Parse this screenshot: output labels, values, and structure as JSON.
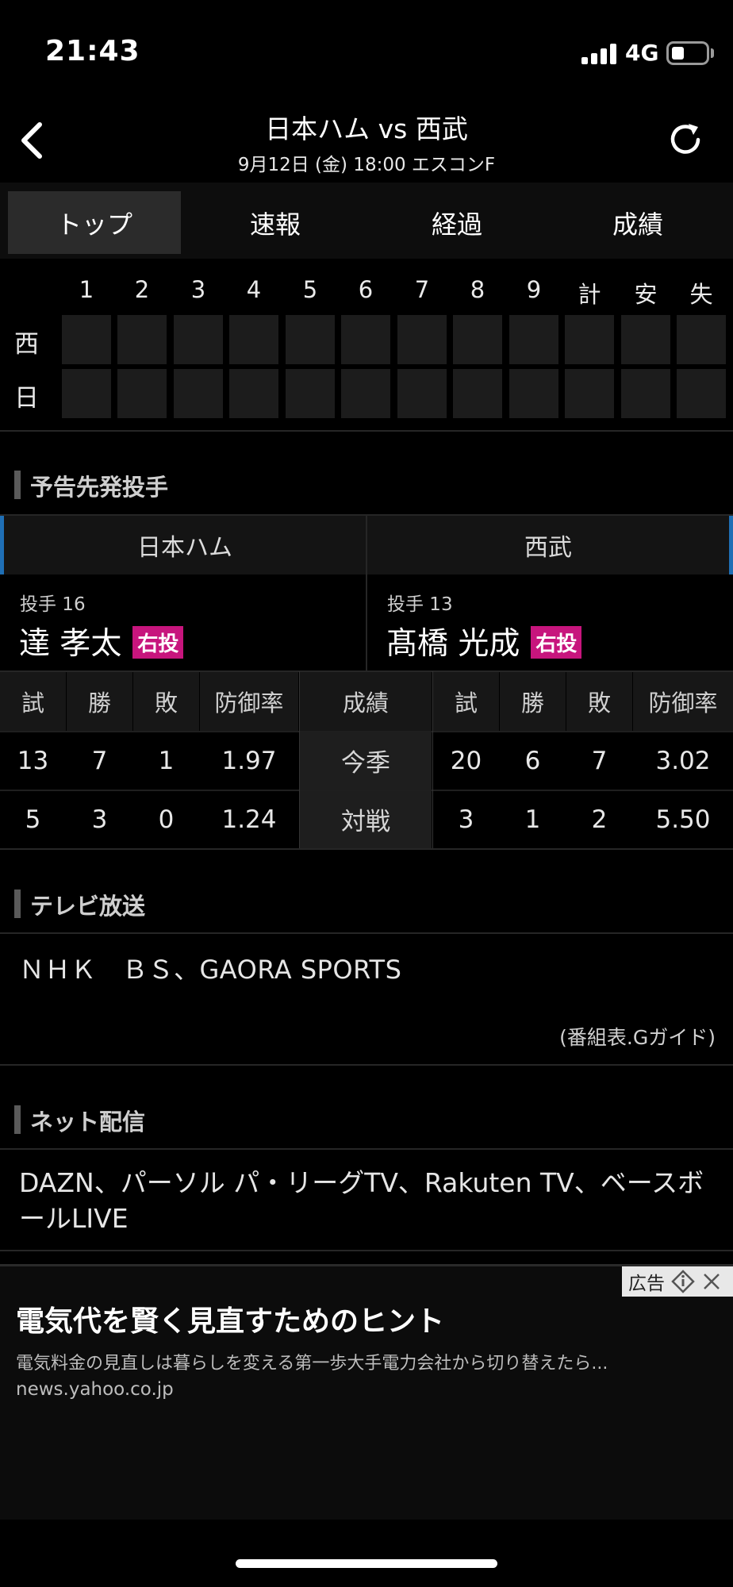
{
  "status_bar": {
    "time": "21:43",
    "network": "4G",
    "battery_level": 0.35
  },
  "header": {
    "title": "日本ハム vs 西武",
    "subtitle": "9月12日 (金) 18:00 エスコンF"
  },
  "tabs": [
    {
      "label": "トップ",
      "active": true
    },
    {
      "label": "速報",
      "active": false
    },
    {
      "label": "経過",
      "active": false
    },
    {
      "label": "成績",
      "active": false
    }
  ],
  "scoreboard": {
    "columns": [
      "1",
      "2",
      "3",
      "4",
      "5",
      "6",
      "7",
      "8",
      "9",
      "計",
      "安",
      "失"
    ],
    "teams": [
      "西",
      "日"
    ]
  },
  "pitchers_section": {
    "title": "予告先発投手",
    "home": {
      "team": "日本ハム",
      "number": "投手 16",
      "name": "達 孝太",
      "throws": "右投"
    },
    "away": {
      "team": "西武",
      "number": "投手 13",
      "name": "髙橋 光成",
      "throws": "右投"
    }
  },
  "stats": {
    "headers": [
      "試",
      "勝",
      "敗",
      "防御率"
    ],
    "middle_header": "成績",
    "rows": [
      {
        "label": "今季",
        "home": [
          "13",
          "7",
          "1",
          "1.97"
        ],
        "away": [
          "20",
          "6",
          "7",
          "3.02"
        ]
      },
      {
        "label": "対戦",
        "home": [
          "5",
          "3",
          "0",
          "1.24"
        ],
        "away": [
          "3",
          "1",
          "2",
          "5.50"
        ]
      }
    ]
  },
  "tv_section": {
    "title": "テレビ放送",
    "channels": "ＮＨＫ　ＢＳ、GAORA SPORTS",
    "guide_link": "(番組表.Gガイド)"
  },
  "net_section": {
    "title": "ネット配信",
    "services": "DAZN、パーソル パ・リーグTV、Rakuten TV、ベースボールLIVE"
  },
  "ad": {
    "badge": "広告",
    "title": "電気代を賢く見直すためのヒント",
    "description": "電気料金の見直しは暮らしを変える第一歩大手電力会社から切り替えたら...",
    "domain": "news.yahoo.co.jp"
  },
  "colors": {
    "background": "#000000",
    "throw_badge": "#c7157d",
    "team_accent": "#1f6fb5"
  }
}
